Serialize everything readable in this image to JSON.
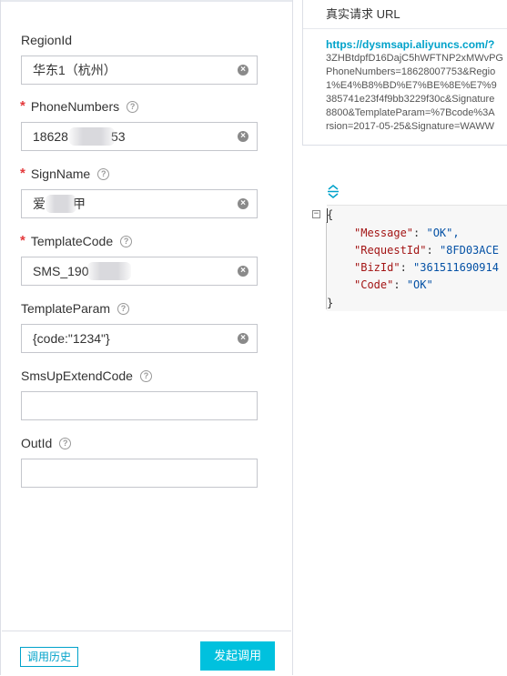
{
  "form": {
    "fields": [
      {
        "label": "RegionId",
        "required": false,
        "help": false,
        "value": "华东1（杭州）",
        "clearable": true
      },
      {
        "label": "PhoneNumbers",
        "required": true,
        "help": true,
        "value": "18628",
        "value_suffix": "53",
        "clearable": true
      },
      {
        "label": "SignName",
        "required": true,
        "help": true,
        "value": "爱",
        "value_suffix": "甲",
        "clearable": true
      },
      {
        "label": "TemplateCode",
        "required": true,
        "help": true,
        "value": "SMS_190",
        "clearable": true
      },
      {
        "label": "TemplateParam",
        "required": false,
        "help": true,
        "value": "{code:\"1234\"}",
        "clearable": true
      },
      {
        "label": "SmsUpExtendCode",
        "required": false,
        "help": true,
        "value": "",
        "clearable": false
      },
      {
        "label": "OutId",
        "required": false,
        "help": true,
        "value": "",
        "clearable": false
      }
    ],
    "required_mark": "*",
    "help_glyph": "?",
    "clear_glyph": "×"
  },
  "footer": {
    "history_label": "调用历史",
    "invoke_label": "发起调用"
  },
  "request_url": {
    "header": "真实请求 URL",
    "link": "https://dysmsapi.aliyuncs.com/?",
    "lines": [
      "3ZHBtdpfD16DajC5hWFTNP2xMWvPG",
      "PhoneNumbers=18628007753&Regio",
      "1%E4%B8%BD%E7%BE%8E%E7%9",
      "385741e23f4f9bb3229f30c&Signature",
      "8800&TemplateParam=%7Bcode%3A",
      "rsion=2017-05-25&Signature=WAWW"
    ]
  },
  "response": {
    "collapse_icon": "collapse-vertical-icon",
    "fold_glyph": "−",
    "open_brace": "{",
    "close_brace": "}",
    "entries": [
      {
        "key": "\"Message\"",
        "value": "\"OK\","
      },
      {
        "key": "\"RequestId\"",
        "value": "\"8FD03ACE"
      },
      {
        "key": "\"BizId\"",
        "value": "\"361511690914"
      },
      {
        "key": "\"Code\"",
        "value": "\"OK\""
      }
    ]
  },
  "colors": {
    "accent": "#00c1de",
    "link": "#00a2ca",
    "required": "#e4393c",
    "json_key": "#a31515",
    "json_string": "#0451a5"
  }
}
